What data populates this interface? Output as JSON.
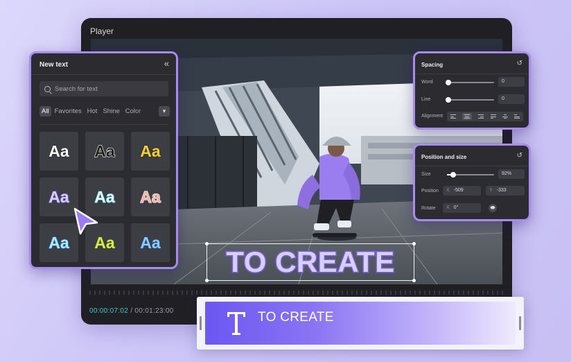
{
  "player": {
    "title": "Player",
    "current_time": "00:00:07:02",
    "separator": "/",
    "duration": "00:01:23:00"
  },
  "new_text_panel": {
    "title": "New text",
    "collapse_icon": "«",
    "search": {
      "placeholder": "Search for text"
    },
    "tabs": [
      "All",
      "Favorites",
      "Hot",
      "Shine",
      "Color"
    ],
    "active_tab": "All",
    "more_icon": "chevron-down-icon",
    "presets": [
      {
        "label": "Aa",
        "fill": "#ffffff",
        "stroke": "#222222"
      },
      {
        "label": "Aa",
        "fill": "#1e1e1e",
        "stroke": "#ffffff"
      },
      {
        "label": "Aa",
        "fill": "#f4d23c",
        "stroke": "#3a2a00"
      },
      {
        "label": "Aa",
        "fill": "#d6ccff",
        "stroke": "#7a5ee0"
      },
      {
        "label": "Aa",
        "fill": "#e6f8ff",
        "stroke": "#3aa9c9"
      },
      {
        "label": "Aa",
        "fill": "#f3b4a8",
        "stroke": "#ffffff"
      },
      {
        "label": "Aa",
        "fill": "#a9ecff",
        "stroke": "#3a78d8"
      },
      {
        "label": "Aa",
        "fill": "#d7e95a",
        "stroke": "#4a5a00"
      },
      {
        "label": "Aa",
        "fill": "#8fcaff",
        "stroke": "#1f4f9c"
      }
    ]
  },
  "spacing_panel": {
    "title": "Spacing",
    "word_label": "Word",
    "word_value": "0",
    "line_label": "Line",
    "line_value": "0",
    "alignment_label": "Alignment",
    "alignment_options": 6,
    "selected_alignment": 1
  },
  "position_panel": {
    "title": "Position and size",
    "size_label": "Size",
    "size_value": "92%",
    "size_fraction": 0.13,
    "position_label": "Position",
    "x_prefix": "X",
    "x_value": "-509",
    "y_prefix": "Y",
    "y_value": "-333",
    "rotate_label": "Rotate",
    "rotate_prefix": "X",
    "rotate_value": "0°"
  },
  "caption": {
    "text": "TO CREATE"
  },
  "timeline": {
    "clip_label": "TO CREATE",
    "clip_icon": "text-T-icon"
  },
  "colors": {
    "accent": "#a68cf0",
    "clip_start": "#6b57f1",
    "timecode": "#3ec6d8",
    "caption_fill": "#d7d0ff",
    "caption_stroke": "#7e63dd"
  }
}
